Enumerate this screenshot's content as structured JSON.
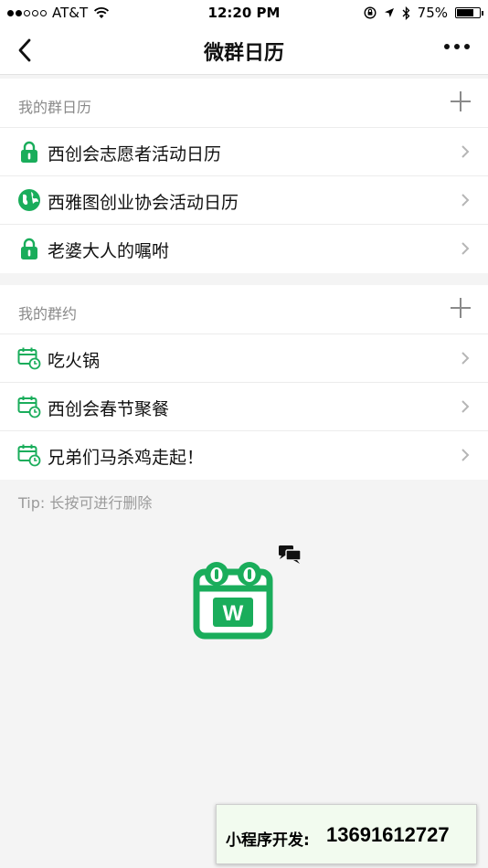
{
  "status_bar": {
    "carrier": "AT&T",
    "time": "12:20 PM",
    "battery_percent": "75%",
    "battery_level": 0.75
  },
  "nav": {
    "title": "微群日历"
  },
  "colors": {
    "accent": "#1aad5b",
    "gray_text": "#8a8a8a"
  },
  "group_calendars": {
    "title": "我的群日历",
    "items": [
      {
        "label": "西创会志愿者活动日历",
        "icon": "lock-icon"
      },
      {
        "label": "西雅图创业协会活动日历",
        "icon": "globe-icon"
      },
      {
        "label": "老婆大人的嘱咐",
        "icon": "lock-icon"
      }
    ]
  },
  "group_appointments": {
    "title": "我的群约",
    "items": [
      {
        "label": "吃火锅",
        "icon": "calendar-clock-icon"
      },
      {
        "label": "西创会春节聚餐",
        "icon": "calendar-clock-icon"
      },
      {
        "label": "兄弟们马杀鸡走起！",
        "icon": "calendar-clock-icon"
      }
    ]
  },
  "tip": "Tip: 长按可进行删除",
  "logo": {
    "letter": "W"
  },
  "footer_badge": {
    "label": "小程序开发:",
    "phone": "13691612727"
  }
}
